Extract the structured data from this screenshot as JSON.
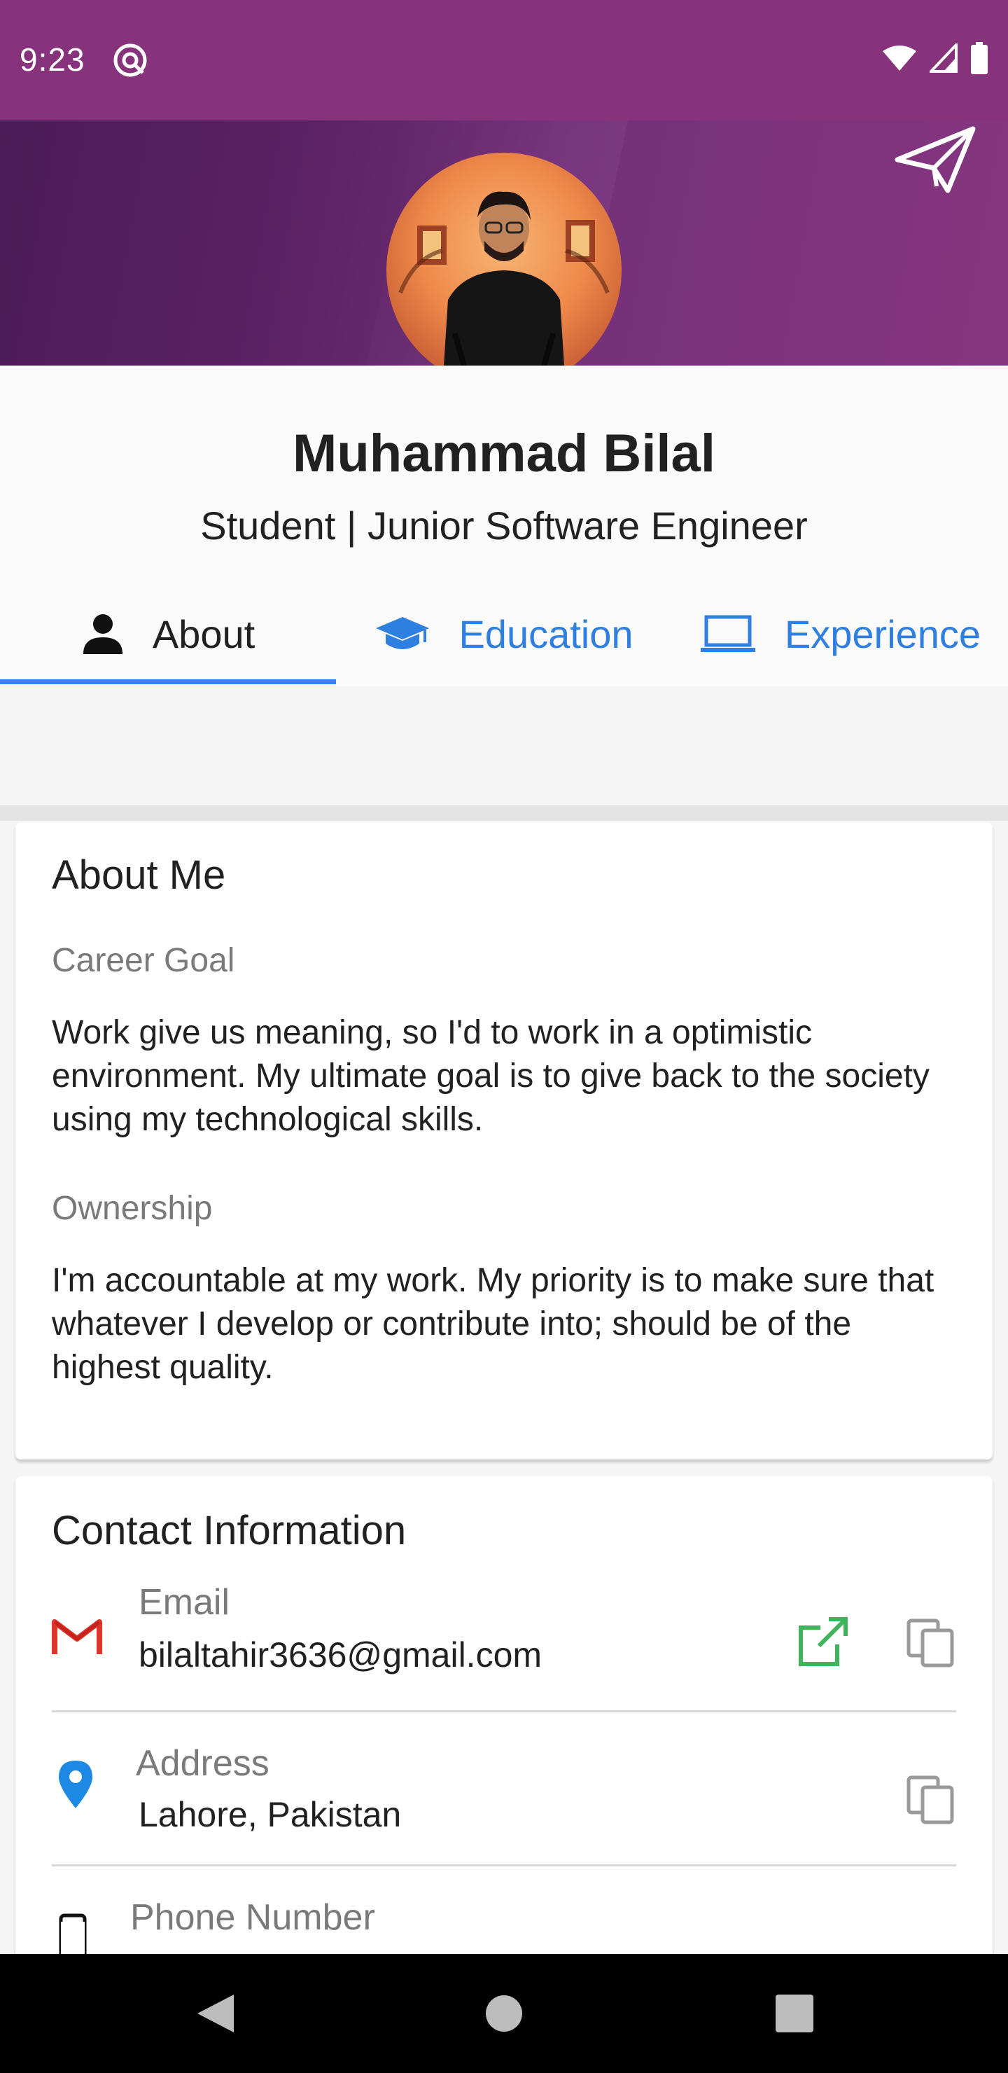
{
  "status_bar": {
    "time": "9:23",
    "bg_color": "#86337c"
  },
  "header": {
    "send_icon": "paper-plane-icon",
    "gradient_start": "#4b1c57",
    "gradient_end": "#86367f"
  },
  "profile": {
    "name": "Muhammad Bilal",
    "subtitle": "Student | Junior Software Engineer"
  },
  "tabs": [
    {
      "label": "About",
      "icon": "person-icon",
      "active": true
    },
    {
      "label": "Education",
      "icon": "graduation-cap-icon",
      "active": false
    },
    {
      "label": "Experience",
      "icon": "laptop-icon",
      "active": false
    }
  ],
  "about": {
    "title": "About Me",
    "career_goal_label": "Career Goal",
    "career_goal_text": "Work give us meaning, so I'd to work in a optimistic environment. My ultimate goal is to give back to the society using my technological skills.",
    "ownership_label": "Ownership",
    "ownership_text": "I'm accountable at my work. My priority is to make sure that whatever I develop or contribute into; should be of the highest quality."
  },
  "contact": {
    "title": "Contact Information",
    "email_label": "Email",
    "email_value": "bilaltahir3636@gmail.com",
    "address_label": "Address",
    "address_value": "Lahore, Pakistan",
    "phone_label": "Phone Number"
  },
  "colors": {
    "accent_blue": "#2f7fe0",
    "open_green": "#3fb45a",
    "gmail_red": "#e0362a",
    "location_blue": "#1e88e5"
  }
}
